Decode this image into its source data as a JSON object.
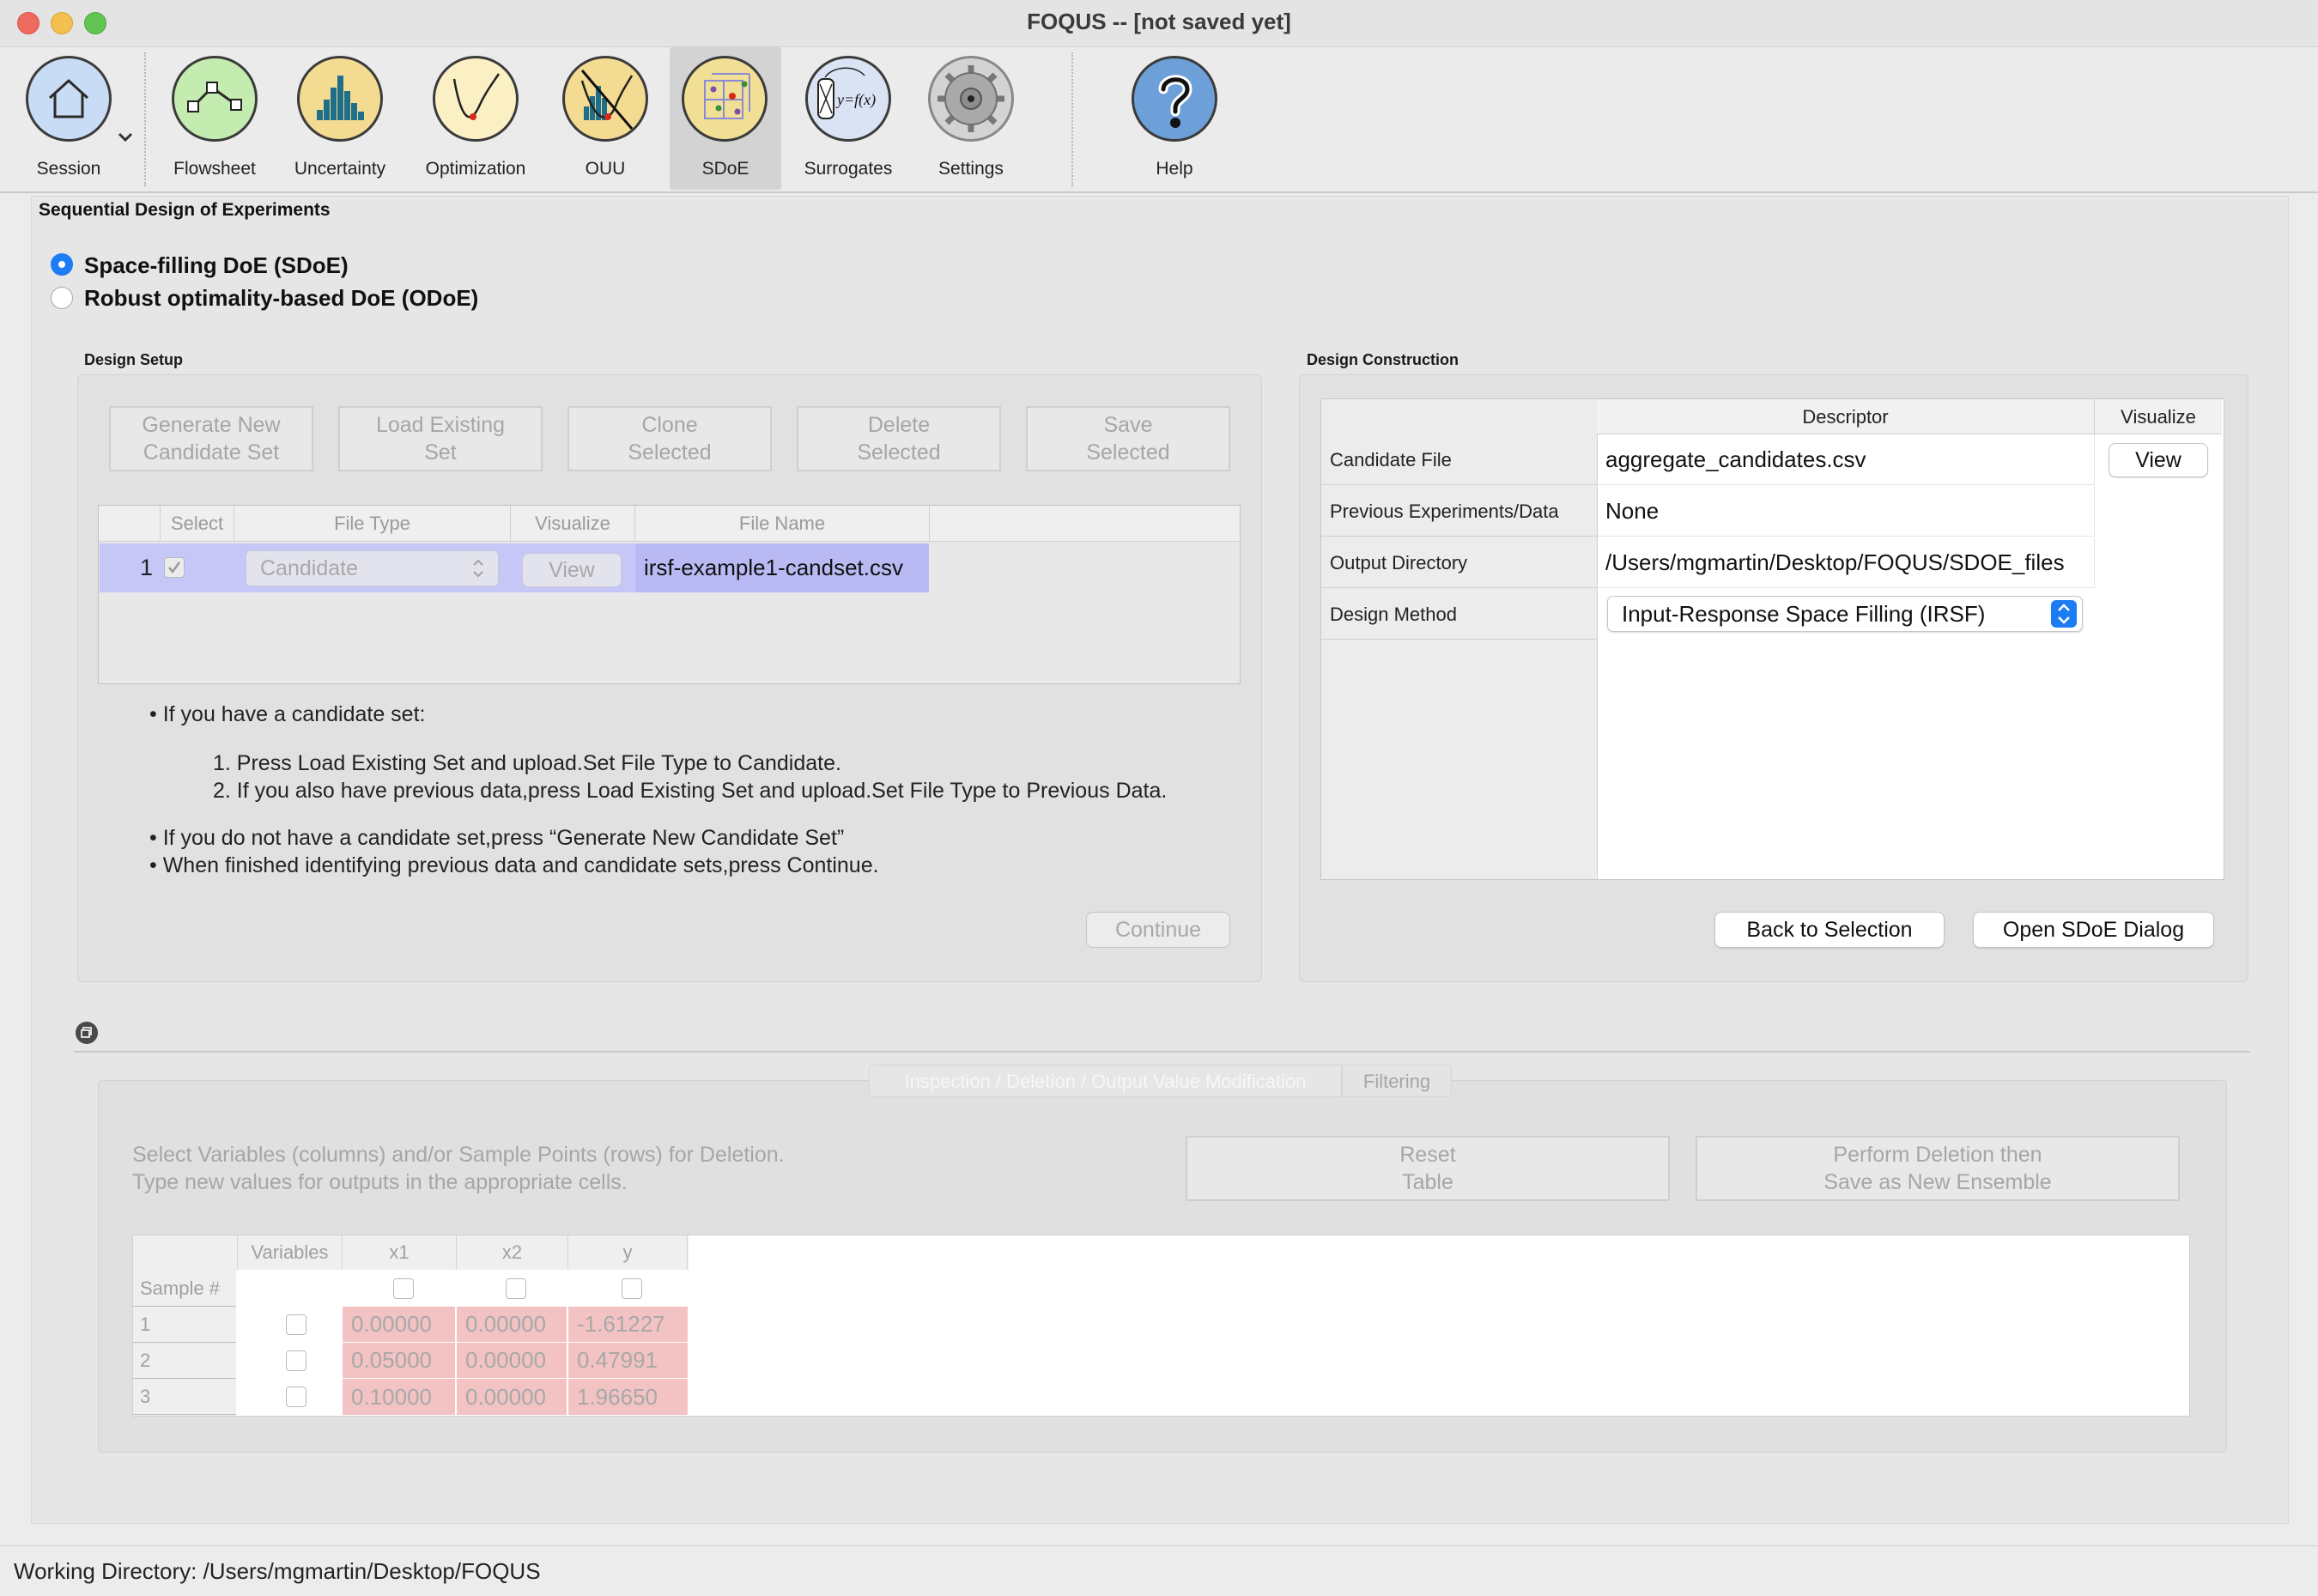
{
  "window": {
    "title": "FOQUS -- [not saved yet]"
  },
  "toolbar": {
    "items": [
      {
        "label": "Session",
        "icon": "home-icon"
      },
      {
        "label": "Flowsheet",
        "icon": "flowsheet-icon"
      },
      {
        "label": "Uncertainty",
        "icon": "histogram-icon"
      },
      {
        "label": "Optimization",
        "icon": "optimization-curve-icon"
      },
      {
        "label": "OUU",
        "icon": "ouu-icon"
      },
      {
        "label": "SDoE",
        "icon": "sdoe-grid-icon"
      },
      {
        "label": "Surrogates",
        "icon": "surrogate-function-icon"
      },
      {
        "label": "Settings",
        "icon": "gear-icon"
      },
      {
        "label": "Help",
        "icon": "help-question-icon"
      }
    ],
    "surrogate_icon_text": "y=f(x)"
  },
  "page": {
    "heading": "Sequential Design of Experiments"
  },
  "mode": {
    "sdoe_label": "Space-filling DoE (SDoE)",
    "odoe_label": "Robust optimality-based DoE (ODoE)",
    "selected": "sdoe"
  },
  "setup": {
    "title": "Design Setup",
    "buttons": [
      {
        "line1": "Generate New",
        "line2": "Candidate Set"
      },
      {
        "line1": "Load Existing",
        "line2": "Set"
      },
      {
        "line1": "Clone",
        "line2": "Selected"
      },
      {
        "line1": "Delete",
        "line2": "Selected"
      },
      {
        "line1": "Save",
        "line2": "Selected"
      }
    ],
    "table": {
      "headers": [
        "Select",
        "File Type",
        "Visualize",
        "File Name"
      ],
      "rows": [
        {
          "index": "1",
          "file_type": "Candidate",
          "visualize": "View",
          "file_name": "irsf-example1-candset.csv"
        }
      ]
    },
    "instructions": {
      "b1": "If you have a candidate set:",
      "s1": "1. Press Load Existing Set and upload.Set File Type to Candidate.",
      "s2": "2. If you also have previous data,press Load Existing Set and upload.Set File Type to Previous Data.",
      "b2": "If you do not have a candidate set,press “Generate New Candidate Set”",
      "b3": "When finished identifying previous data and candidate sets,press Continue."
    },
    "continue_label": "Continue"
  },
  "construction": {
    "title": "Design Construction",
    "headers": {
      "descriptor": "Descriptor",
      "visualize": "Visualize"
    },
    "rows": [
      {
        "label": "Candidate File",
        "value": "aggregate_candidates.csv",
        "action": "View"
      },
      {
        "label": "Previous Experiments/Data",
        "value": "None"
      },
      {
        "label": "Output Directory",
        "value": "/Users/mgmartin/Desktop/FOQUS/SDOE_files"
      },
      {
        "label": "Design Method",
        "value": "Input-Response Space Filling (IRSF)"
      }
    ],
    "back_label": "Back to Selection",
    "open_label": "Open SDoE Dialog"
  },
  "inspection": {
    "tabs": [
      "Inspection / Deletion / Output Value Modification",
      "Filtering"
    ],
    "help_line1": "Select Variables (columns) and/or Sample Points (rows) for Deletion.",
    "help_line2": "Type new values for outputs in the appropriate cells.",
    "reset_line1": "Reset",
    "reset_line2": "Table",
    "perform_line1": "Perform Deletion then",
    "perform_line2": "Save as New Ensemble",
    "headers": [
      "Variables",
      "x1",
      "x2",
      "y"
    ],
    "sample_header": "Sample #",
    "rows": [
      {
        "n": "1",
        "x1": "0.00000",
        "x2": "0.00000",
        "y": "-1.61227"
      },
      {
        "n": "2",
        "x1": "0.05000",
        "x2": "0.00000",
        "y": "0.47991"
      },
      {
        "n": "3",
        "x1": "0.10000",
        "x2": "0.00000",
        "y": "1.96650"
      }
    ]
  },
  "status": {
    "text": "Working Directory: /Users/mgmartin/Desktop/FOQUS"
  },
  "colors": {
    "accent": "#1c7cf4",
    "selection": "#c6c6f7",
    "deleted_cell": "#f3c3c3"
  }
}
